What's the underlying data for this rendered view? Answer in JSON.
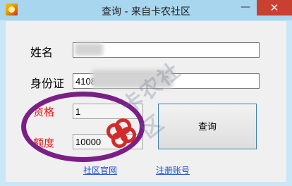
{
  "window": {
    "title": "查询 - 来自卡农社区",
    "minimize_glyph": "—",
    "close_glyph": "✕"
  },
  "form": {
    "name_label": "姓名",
    "name_value": "",
    "id_label": "身份证",
    "id_value": "4108",
    "qualification_label": "资格",
    "qualification_value": "1",
    "quota_label": "额度",
    "quota_value": "10000"
  },
  "buttons": {
    "query": "查询"
  },
  "links": {
    "community": "社区官网",
    "register": "注册账号"
  },
  "watermark": {
    "text": "卡农社区"
  },
  "colors": {
    "red_label": "#e61a1a",
    "highlight_ellipse": "#7a1f86",
    "link": "#1a4fd6",
    "close_button": "#c93f30"
  }
}
